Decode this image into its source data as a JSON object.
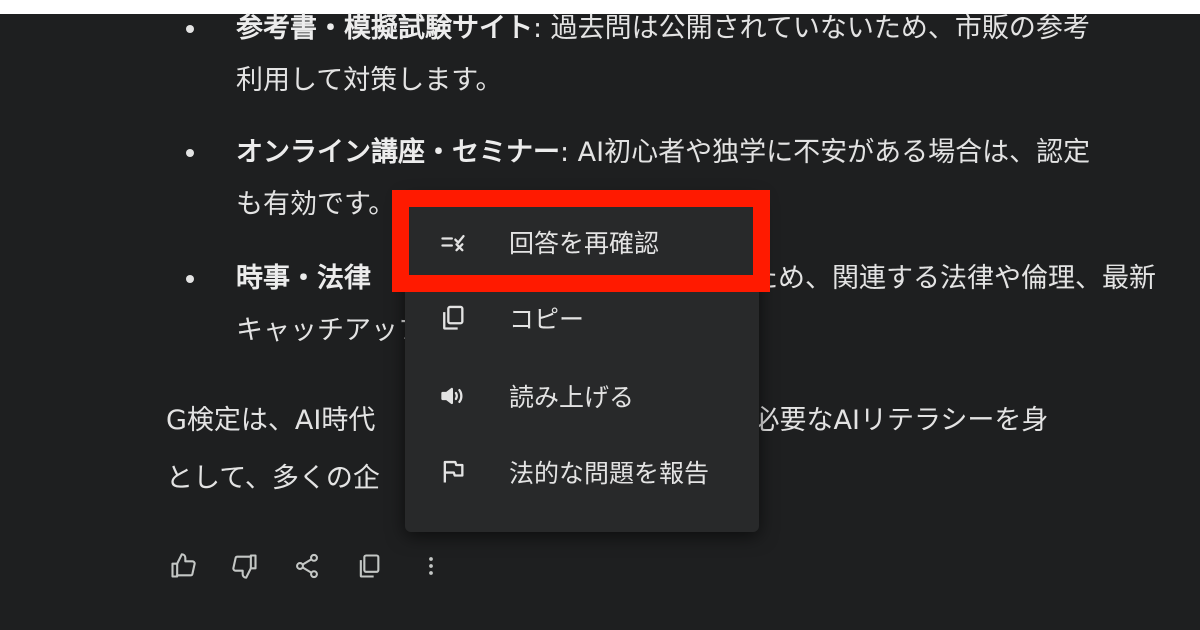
{
  "list": {
    "items": [
      {
        "title": "参考書・模擬試験サイト",
        "line1_rest": ": 過去問は公開されていないため、市販の参考",
        "line2": "利用して対策します。"
      },
      {
        "title": "オンライン講座・セミナー",
        "line1_rest": ": AI初心者や独学に不安がある場合は、認定",
        "line2": "も有効です。"
      },
      {
        "title": "時事・法律",
        "line1_rest": "ため、関連する法律や倫理、最新",
        "line2": "キャッチアップします。"
      }
    ]
  },
  "paragraph": {
    "line1": "G検定は、AI時代　　　　　　　　　　ンとして必要なAIリテラシーを身",
    "line2": "として、多くの企　　　　　　　　　ます。"
  },
  "context_menu": {
    "items": [
      {
        "label": "回答を再確認",
        "icon": "double-check-icon"
      },
      {
        "label": "コピー",
        "icon": "copy-icon"
      },
      {
        "label": "読み上げる",
        "icon": "speaker-icon"
      },
      {
        "label": "法的な問題を報告",
        "icon": "flag-icon"
      }
    ]
  },
  "action_bar": {
    "icons": [
      "thumbs-up-icon",
      "thumbs-down-icon",
      "share-icon",
      "copy-icon",
      "more-vert-icon"
    ]
  },
  "colors": {
    "background": "#1e1f20",
    "menu_background": "#28292a",
    "text": "#e3e3e3",
    "highlight": "#ff1a00"
  }
}
